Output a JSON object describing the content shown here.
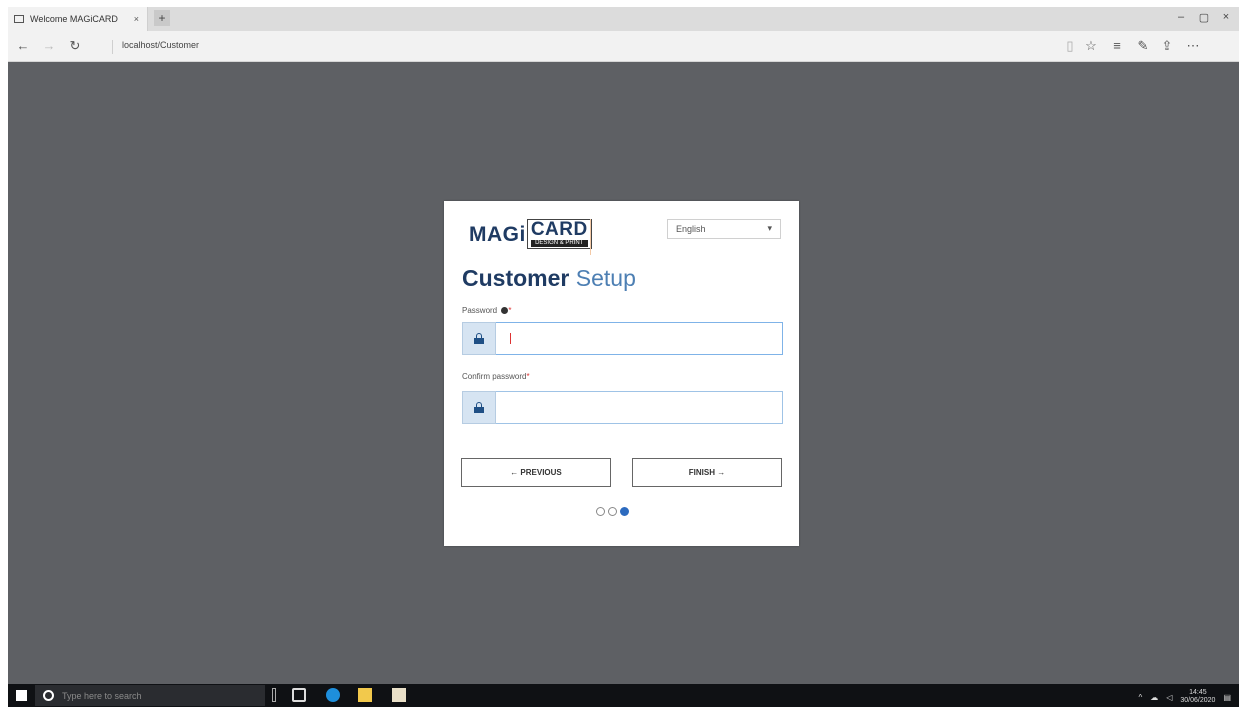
{
  "browser": {
    "tab_title": "Welcome MAGiCARD",
    "tab_close": "×",
    "new_tab": "+",
    "window_controls": [
      "–",
      "▢",
      "×"
    ],
    "address": "localhost/Customer"
  },
  "card": {
    "logo": {
      "left": "MAGi",
      "box": "CARD",
      "sub": "DESIGN & PRINT"
    },
    "language": {
      "value": "English",
      "caret": "▾"
    },
    "title_part1": "Customer",
    "title_part2": "Setup",
    "password_label": "Password",
    "password_required": "*",
    "confirm_label": "Confirm password",
    "confirm_required": "*",
    "password_value": "",
    "confirm_value": "",
    "previous_button": "← PREVIOUS",
    "finish_button": "FINISH →",
    "steps": {
      "total": 3,
      "current": 3
    }
  },
  "taskbar": {
    "search_placeholder": "Type here to search",
    "clock_time": "14:45",
    "clock_date": "30/06/2020"
  },
  "colors": {
    "backdrop": "#5e6064",
    "brand_navy": "#1f3b63",
    "brand_blue": "#4d7fb3",
    "step_active": "#2d6bbf"
  }
}
